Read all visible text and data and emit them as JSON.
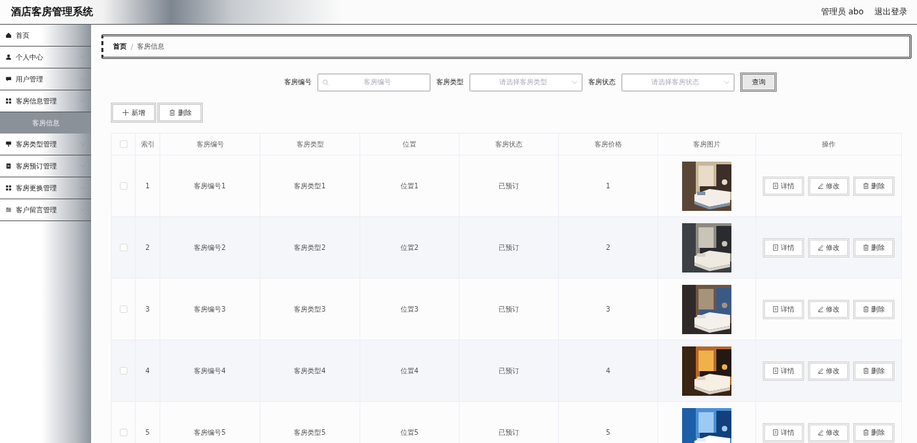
{
  "header": {
    "title": "酒店客房管理系统",
    "user": "管理员 abo",
    "logout": "退出登录"
  },
  "sidebar": {
    "items": [
      {
        "label": "首页",
        "kind": "link"
      },
      {
        "label": "个人中心",
        "kind": "menu"
      },
      {
        "label": "用户管理",
        "kind": "menu"
      },
      {
        "label": "客房信息管理",
        "kind": "menu",
        "children": [
          {
            "label": "客房信息",
            "selected": true
          }
        ]
      },
      {
        "label": "客房类型管理",
        "kind": "menu"
      },
      {
        "label": "客房预订管理",
        "kind": "menu"
      },
      {
        "label": "客房更换管理",
        "kind": "menu"
      },
      {
        "label": "客户留言管理",
        "kind": "menu"
      }
    ]
  },
  "breadcrumb": {
    "separator": "/",
    "items": [
      {
        "label": "首页",
        "selected": false
      },
      {
        "label": "客房信息",
        "selected": true
      }
    ]
  },
  "search": {
    "fields": [
      {
        "label": "客房编号",
        "kind": "input",
        "placeholder": "客房编号"
      },
      {
        "label": "客房类型",
        "kind": "select",
        "placeholder": "请选择客房类型"
      },
      {
        "label": "客房状态",
        "kind": "select",
        "placeholder": "请选择客房状态"
      }
    ],
    "button": "查询"
  },
  "toolbar": [
    {
      "kind": "add",
      "label": "新增"
    },
    {
      "kind": "delete",
      "label": "删除"
    }
  ],
  "table": {
    "all_checked": false,
    "columns": [
      "索引",
      "客房编号",
      "客房类型",
      "位置",
      "客房状态",
      "客房价格",
      "客房图片",
      "操作"
    ],
    "rows": [
      {
        "checked": false,
        "cells": [
          "1",
          "客房编号1",
          "客房类型1",
          "位置1",
          "已预订",
          "1"
        ],
        "actions": [
          {
            "kind": "detail",
            "label": "详情"
          },
          {
            "kind": "edit",
            "label": "修改"
          },
          {
            "kind": "delete",
            "label": "删除"
          }
        ]
      },
      {
        "checked": false,
        "cells": [
          "2",
          "客房编号2",
          "客房类型2",
          "位置2",
          "已预订",
          "2"
        ],
        "actions": [
          {
            "kind": "detail",
            "label": "详情"
          },
          {
            "kind": "edit",
            "label": "修改"
          },
          {
            "kind": "delete",
            "label": "删除"
          }
        ]
      },
      {
        "checked": false,
        "cells": [
          "3",
          "客房编号3",
          "客房类型3",
          "位置3",
          "已预订",
          "3"
        ],
        "actions": [
          {
            "kind": "detail",
            "label": "详情"
          },
          {
            "kind": "edit",
            "label": "修改"
          },
          {
            "kind": "delete",
            "label": "删除"
          }
        ]
      },
      {
        "checked": false,
        "cells": [
          "4",
          "客房编号4",
          "客房类型4",
          "位置4",
          "已预订",
          "4"
        ],
        "actions": [
          {
            "kind": "detail",
            "label": "详情"
          },
          {
            "kind": "edit",
            "label": "修改"
          },
          {
            "kind": "delete",
            "label": "删除"
          }
        ]
      },
      {
        "checked": false,
        "cells": [
          "5",
          "客房编号5",
          "客房类型5",
          "位置5",
          "已预订",
          "5"
        ],
        "actions": [
          {
            "kind": "detail",
            "label": "详情"
          },
          {
            "kind": "edit",
            "label": "修改"
          },
          {
            "kind": "delete",
            "label": "删除"
          }
        ]
      }
    ]
  }
}
